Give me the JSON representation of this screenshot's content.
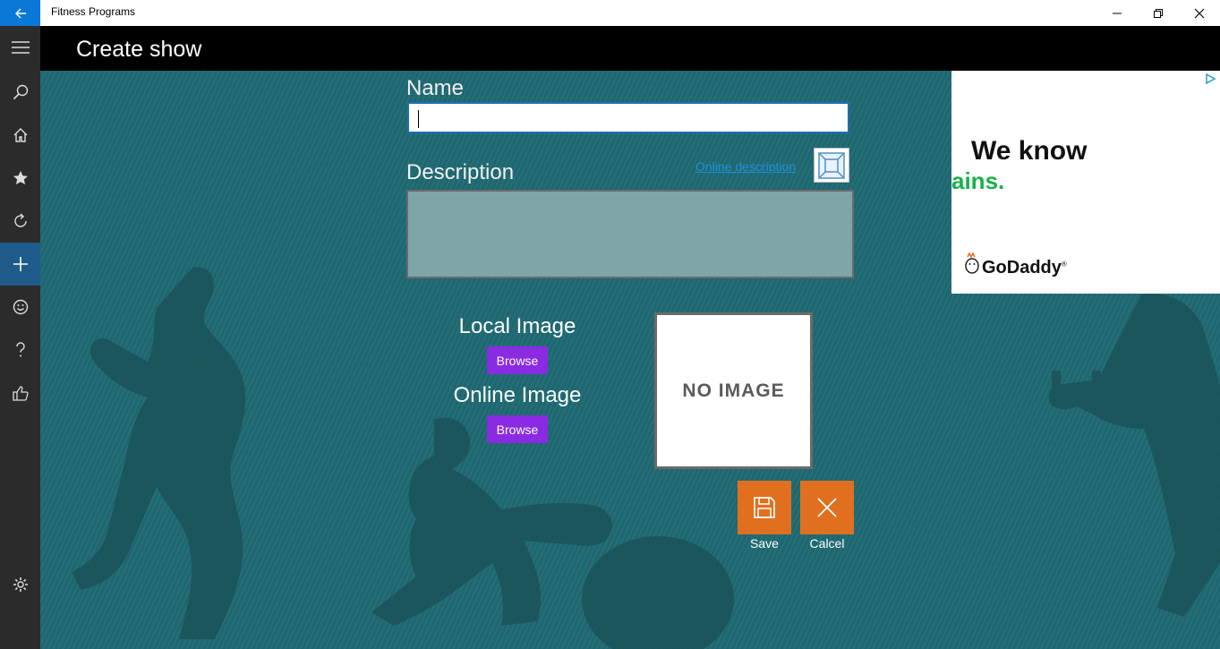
{
  "window": {
    "app_title": "Fitness Programs",
    "controls": [
      "minimize",
      "restore",
      "close"
    ]
  },
  "header": {
    "title": "Create show"
  },
  "sidebar": {
    "items": [
      {
        "icon": "hamburger-icon"
      },
      {
        "icon": "search-icon"
      },
      {
        "icon": "home-icon"
      },
      {
        "icon": "star-icon"
      },
      {
        "icon": "refresh-icon"
      },
      {
        "icon": "plus-icon",
        "active": true
      },
      {
        "icon": "smiley-icon"
      },
      {
        "icon": "question-icon"
      },
      {
        "icon": "thumbs-up-icon"
      },
      {
        "icon": "gear-icon"
      }
    ]
  },
  "form": {
    "name_label": "Name",
    "name_value": "",
    "description_label": "Description",
    "online_description_link": "Online description",
    "description_value": "",
    "local_image_label": "Local Image",
    "local_browse": "Browse",
    "online_image_label": "Online Image",
    "online_browse": "Browse",
    "no_image_text": "NO IMAGE",
    "save_label": "Save",
    "cancel_label": "Calcel"
  },
  "ad": {
    "line1": "We know",
    "line2": "ains.",
    "brand": "GoDaddy",
    "brand_mark": "®"
  },
  "colors": {
    "accent_blue": "#0a78d7",
    "browse_purple": "#8a2be2",
    "action_orange": "#e07020",
    "background_teal": "#1f6a73"
  }
}
